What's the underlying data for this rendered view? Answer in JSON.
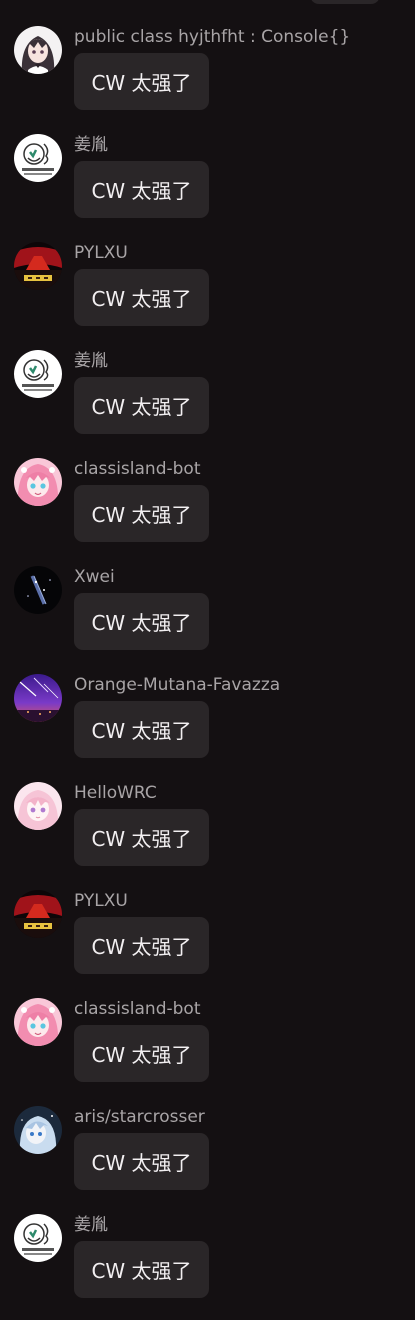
{
  "messages": [
    {
      "sender": "public class hyjthfht : Console{}",
      "text": "CW 太强了",
      "avatar": "anime-girl-dark-hair-avatar"
    },
    {
      "sender": "姜胤",
      "text": "CW 太强了",
      "avatar": "white-sticker-avatar"
    },
    {
      "sender": "PYLXU",
      "text": "CW 太强了",
      "avatar": "red-sky-avatar"
    },
    {
      "sender": "姜胤",
      "text": "CW 太强了",
      "avatar": "white-sticker-avatar"
    },
    {
      "sender": "classisland-bot",
      "text": "CW 太强了",
      "avatar": "pink-anime-girl-avatar"
    },
    {
      "sender": "Xwei",
      "text": "CW 太强了",
      "avatar": "dark-space-avatar"
    },
    {
      "sender": "Orange-Mutana-Favazza",
      "text": "CW 太强了",
      "avatar": "purple-meteor-sky-avatar"
    },
    {
      "sender": "HelloWRC",
      "text": "CW 太强了",
      "avatar": "light-pink-anime-girl-avatar"
    },
    {
      "sender": "PYLXU",
      "text": "CW 太强了",
      "avatar": "red-sky-avatar"
    },
    {
      "sender": "classisland-bot",
      "text": "CW 太强了",
      "avatar": "pink-anime-girl-avatar"
    },
    {
      "sender": "aris/starcrosser",
      "text": "CW 太强了",
      "avatar": "blue-anime-character-avatar"
    },
    {
      "sender": "姜胤",
      "text": "CW 太强了",
      "avatar": "white-sticker-avatar"
    }
  ],
  "colors": {
    "background": "#141012",
    "bubble": "#2a2628",
    "sender_text": "#a8a4a6",
    "message_text": "#f2eff1"
  }
}
